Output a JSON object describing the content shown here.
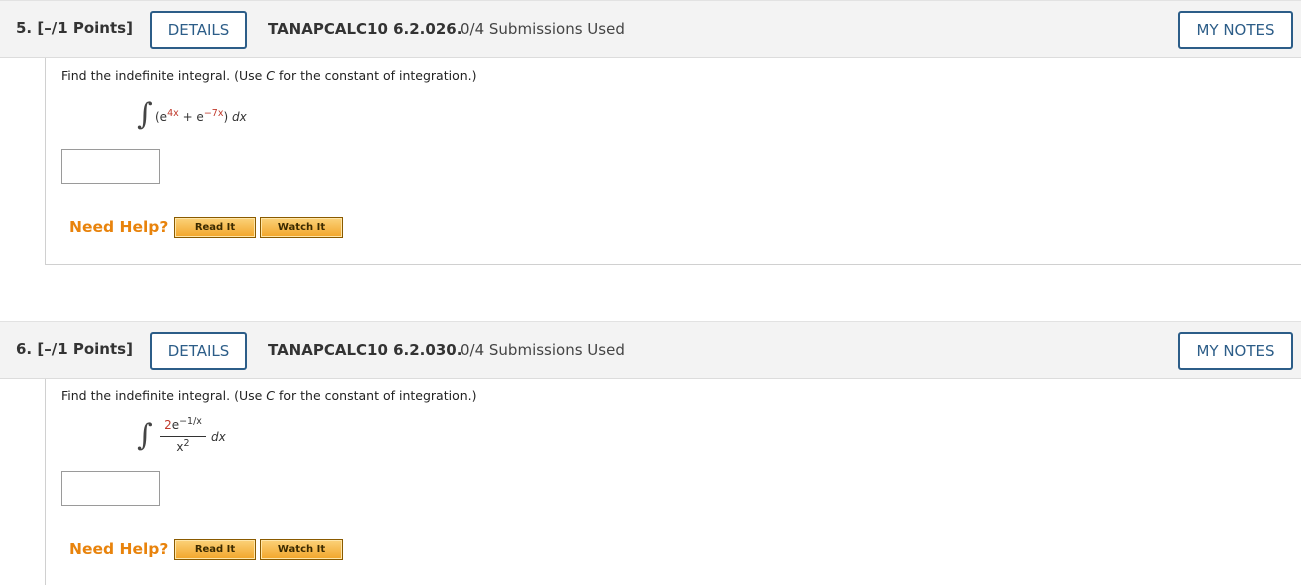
{
  "questions": [
    {
      "number": "5. [–/1 Points]",
      "details_label": "DETAILS",
      "code": "TANAPCALC10 6.2.026.",
      "submissions": "0/4 Submissions Used",
      "notes_label": "MY NOTES",
      "prompt_before": "Find the indefinite integral. (Use ",
      "prompt_var": "C",
      "prompt_after": " for the constant of integration.)",
      "integral": {
        "open": "(e",
        "exp1": "4x",
        "plus": " + e",
        "exp2": "−7x",
        "close": ") ",
        "dx": "dx"
      },
      "answer_value": "",
      "need_help": "Need Help?",
      "read_label": "Read It",
      "watch_label": "Watch It"
    },
    {
      "number": "6. [–/1 Points]",
      "details_label": "DETAILS",
      "code": "TANAPCALC10 6.2.030.",
      "submissions": "0/4 Submissions Used",
      "notes_label": "MY NOTES",
      "prompt_before": "Find the indefinite integral. (Use ",
      "prompt_var": "C",
      "prompt_after": " for the constant of integration.)",
      "integral": {
        "num_coef": "2",
        "num_base": "e",
        "num_exp": "−1/x",
        "den_base": "x",
        "den_exp": "2",
        "dx": "dx"
      },
      "answer_value": "",
      "need_help": "Need Help?",
      "read_label": "Read It",
      "watch_label": "Watch It"
    }
  ],
  "integral_symbol": "∫",
  "colors": {
    "accent_blue": "#2c5d88",
    "help_orange": "#e8830c",
    "math_red": "#c0392b",
    "header_bg": "#f3f3f3"
  }
}
